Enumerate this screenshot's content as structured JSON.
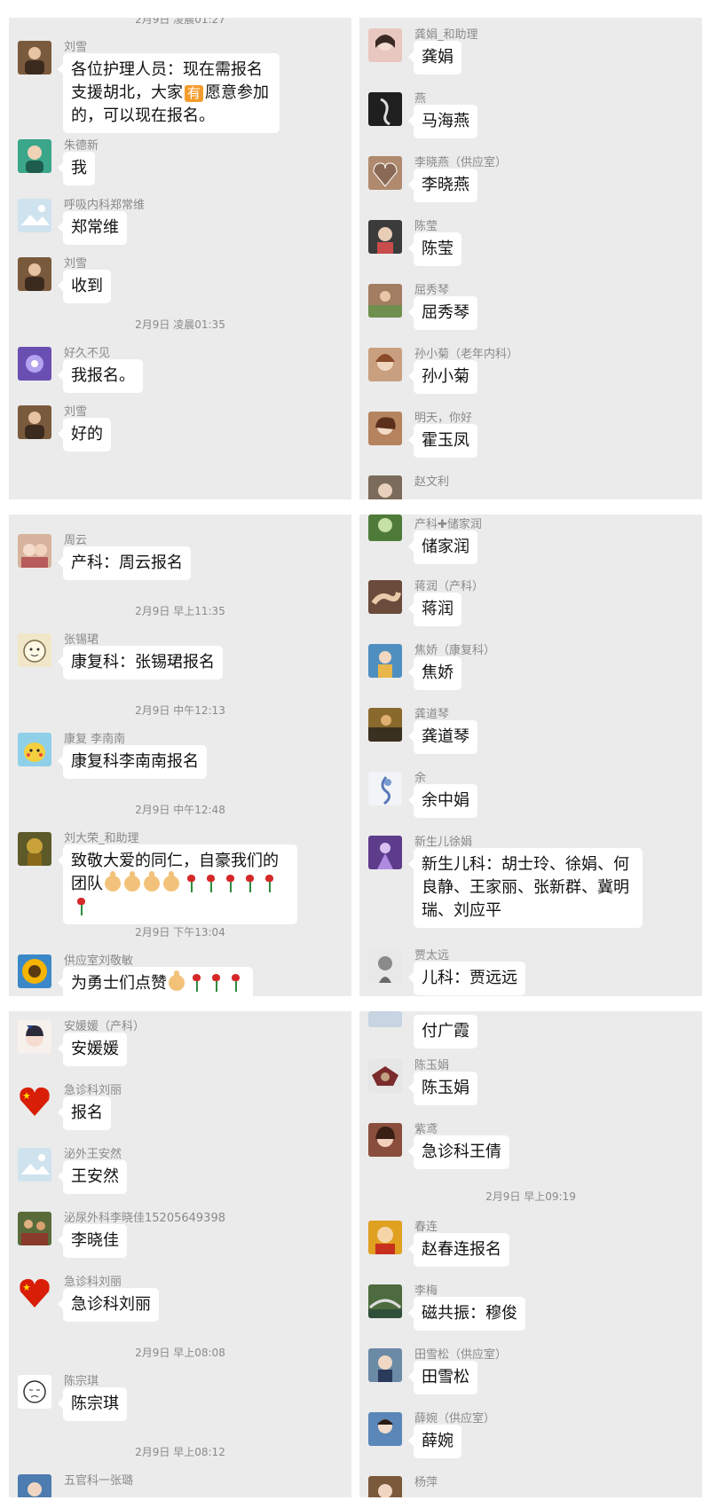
{
  "panels": [
    {
      "id": "p1",
      "timestamp_cut": "2月9日 凌晨01:27",
      "items": [
        {
          "sender": "刘雪",
          "text_parts": [
            "各位护理人员：现在需报名支援胡北，大家",
            "有",
            "愿意参加的，可以现在报名。"
          ]
        },
        {
          "sender": "朱德新",
          "text": "我"
        },
        {
          "sender": "呼吸内科郑常维",
          "text": "郑常维"
        },
        {
          "sender": "刘雪",
          "text": "收到"
        },
        {
          "timestamp": "2月9日 凌晨01:35"
        },
        {
          "sender": "好久不见",
          "text": "我报名。"
        },
        {
          "sender": "刘雪",
          "text": "好的"
        }
      ]
    },
    {
      "id": "p2",
      "items": [
        {
          "sender": "龚娟_和助理",
          "text": "龚娟"
        },
        {
          "sender": "燕",
          "text": "马海燕"
        },
        {
          "sender": "李晓燕（供应室）",
          "text": "李晓燕"
        },
        {
          "sender": "陈莹",
          "text": "陈莹"
        },
        {
          "sender": "屈秀琴",
          "text": "屈秀琴"
        },
        {
          "sender": "孙小菊（老年内科）",
          "text": "孙小菊"
        },
        {
          "sender": "明天，你好",
          "text": "霍玉凤"
        },
        {
          "sender": "赵文利",
          "text": ""
        }
      ]
    },
    {
      "id": "p3",
      "items": [
        {
          "sender": "周云",
          "text": "产科：周云报名"
        },
        {
          "timestamp": "2月9日 早上11:35"
        },
        {
          "sender": "张锡珺",
          "text": "康复科：张锡珺报名"
        },
        {
          "timestamp": "2月9日 中午12:13"
        },
        {
          "sender": "康复 李南南",
          "text": "康复科李南南报名"
        },
        {
          "timestamp": "2月9日 中午12:48"
        },
        {
          "sender": "刘大荣_和助理",
          "text": "致敬大爱的同仁，自豪我们的团队"
        },
        {
          "timestamp": "2月9日 下午13:04"
        },
        {
          "sender": "供应室刘敬敏",
          "text": "为勇士们点赞"
        }
      ]
    },
    {
      "id": "p4",
      "items": [
        {
          "sender": "产科✚储家润",
          "text": "储家润"
        },
        {
          "sender": "蒋润（产科）",
          "text": "蒋润"
        },
        {
          "sender": "焦娇（康复科）",
          "text": "焦娇"
        },
        {
          "sender": "龚道琴",
          "text": "龚道琴"
        },
        {
          "sender": "余",
          "text": "余中娟"
        },
        {
          "sender": "新生儿徐娟",
          "text": "新生儿科：胡士玲、徐娟、何良静、王家丽、张新群、冀明瑞、刘应平"
        },
        {
          "sender": "贾太远",
          "text": "儿科：贾远远"
        }
      ]
    },
    {
      "id": "p5",
      "items": [
        {
          "sender": "安媛媛（产科）",
          "text": "安媛媛"
        },
        {
          "sender": "急诊科刘丽",
          "text": "报名"
        },
        {
          "sender": "泌外王安然",
          "text": "王安然"
        },
        {
          "sender": "泌尿外科李晓佳15205649398",
          "text": "李晓佳"
        },
        {
          "sender": "急诊科刘丽",
          "text": "急诊科刘丽"
        },
        {
          "timestamp": "2月9日 早上08:08"
        },
        {
          "sender": "陈宗琪",
          "text": "陈宗琪"
        },
        {
          "timestamp": "2月9日 早上08:12"
        },
        {
          "sender": "五官科一张璐",
          "text": ""
        }
      ]
    },
    {
      "id": "p6",
      "items": [
        {
          "sender": "",
          "text": "付广霞"
        },
        {
          "sender": "陈玉娟",
          "text": "陈玉娟"
        },
        {
          "sender": "紫鸢",
          "text": "急诊科王倩"
        },
        {
          "timestamp": "2月9日 早上09:19"
        },
        {
          "sender": "春连",
          "text": "赵春连报名"
        },
        {
          "sender": "李梅",
          "text": "磁共振：穆俊"
        },
        {
          "sender": "田雪松（供应室）",
          "text": "田雪松"
        },
        {
          "sender": "薛婉（供应室）",
          "text": "薛婉"
        },
        {
          "sender": "杨萍",
          "text": ""
        }
      ]
    }
  ],
  "avatar_colors": {
    "liuxue": "#7a5a3c",
    "zhudexin": "#3aa68a",
    "placeholder": "#cfe3ef",
    "haojiu": "#6a4fb3",
    "gongjuan": "#e8c7c0",
    "yan": "#1f1f1f",
    "lixiaoyan": "#b08a6e",
    "chenying": "#3b3b3b",
    "quxiuqin": "#a37d62",
    "sunxiaoju": "#c9a07f",
    "mingtian": "#b5835e",
    "zhaowenli": "#7b6b5a",
    "zhouyun": "#d7b39d",
    "zhangxijun": "#f1e6c8",
    "linannan": "#f4d03f",
    "liudarong": "#5d5a2a",
    "liujingmin": "#f5b400",
    "chujiarun": "#4e7b3a",
    "jiangrun": "#6b4b3b",
    "jiaojiao": "#4f8fc0",
    "gongdaoqin": "#8a6a2c",
    "yu": "#d8dde8",
    "xujuan": "#5d3c8c",
    "jiataiyuan": "#9a9a9a",
    "anyuanyuan": "#f7f1ee",
    "liuli": "#d81e06",
    "lixiaojia": "#5a6b3a",
    "chenzongqi": "#ffffff",
    "zhanglu": "#4c7cb0",
    "fuguangxia": "#c7d4e1",
    "chenyujuan": "#7b2b2b",
    "ziyuan": "#8a4f3c",
    "chunlian": "#e0a020",
    "limei": "#4d6b3e",
    "tianxuesong": "#6b8aa6",
    "xuewan": "#5a86b8",
    "yangping": "#7b5a3c"
  }
}
